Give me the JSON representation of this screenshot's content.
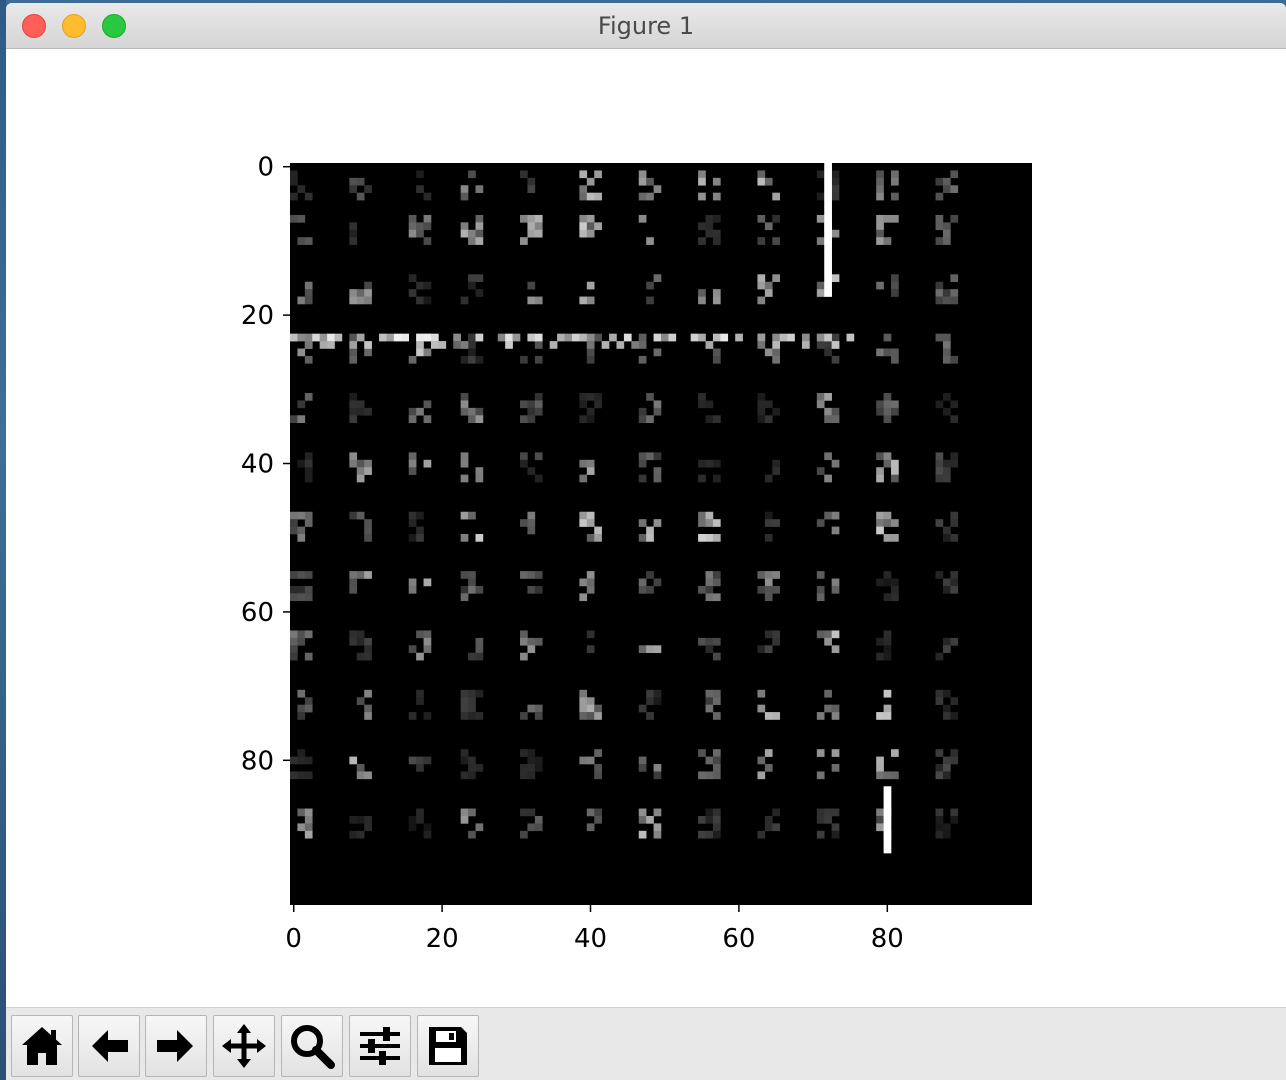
{
  "window": {
    "title": "Figure 1"
  },
  "toolbar": {
    "buttons": [
      {
        "name": "home-button",
        "icon": "home-icon"
      },
      {
        "name": "back-button",
        "icon": "arrow-left-icon"
      },
      {
        "name": "forward-button",
        "icon": "arrow-right-icon"
      },
      {
        "name": "pan-button",
        "icon": "move-icon"
      },
      {
        "name": "zoom-button",
        "icon": "magnifier-icon"
      },
      {
        "name": "configure-subplots-button",
        "icon": "sliders-icon"
      },
      {
        "name": "save-button",
        "icon": "floppy-disk-icon"
      }
    ]
  },
  "chart_data": {
    "type": "heatmap",
    "colormap": "gray",
    "rows": 100,
    "cols": 100,
    "xlim": [
      0,
      99
    ],
    "ylim": [
      99,
      0
    ],
    "x_ticks": [
      "0",
      "20",
      "40",
      "60",
      "80"
    ],
    "y_ticks": [
      "0",
      "20",
      "40",
      "60",
      "80"
    ],
    "grid": false,
    "block_rows": [
      1,
      7,
      15,
      23,
      31,
      39,
      47,
      55,
      63,
      71,
      79,
      87
    ],
    "block_cols": [
      0,
      8,
      16,
      23,
      31,
      39,
      47,
      55,
      63,
      71,
      79,
      87
    ],
    "features": {
      "bright_vertical_line": {
        "col": 72,
        "rows": [
          0,
          17
        ]
      },
      "bright_vertical_line_2": {
        "col": 80,
        "rows": [
          84,
          92
        ]
      },
      "dense_row": {
        "row": 23,
        "cols": [
          0,
          75
        ]
      }
    }
  }
}
